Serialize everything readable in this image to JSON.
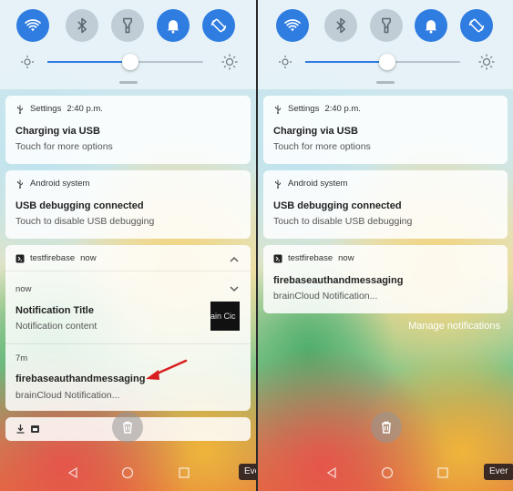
{
  "left_panel": {
    "usb_notification": {
      "app": "Settings",
      "time": "2:40 p.m.",
      "title": "Charging via USB",
      "text": "Touch for more options"
    },
    "debug_notification": {
      "app": "Android system",
      "title": "USB debugging connected",
      "text": "Touch to disable USB debugging"
    },
    "group": {
      "app": "testfirebase",
      "time": "now",
      "item1": {
        "time": "now",
        "title": "Notification Title",
        "text": "Notification content",
        "thumbnail_text": "ain Cic"
      },
      "item2": {
        "time": "7m",
        "title": "firebaseauthandmessaging",
        "text": "brainCloud Notification..."
      }
    },
    "corner_label": "Ever"
  },
  "right_panel": {
    "usb_notification": {
      "app": "Settings",
      "time": "2:40 p.m.",
      "title": "Charging via USB",
      "text": "Touch for more options"
    },
    "debug_notification": {
      "app": "Android system",
      "title": "USB debugging connected",
      "text": "Touch to disable USB debugging"
    },
    "fb_notification": {
      "app": "testfirebase",
      "time": "now",
      "title": "firebaseauthandmessaging",
      "text": "brainCloud Notification..."
    },
    "manage_label": "Manage notifications",
    "corner_label": "Ever"
  },
  "quick_settings": {
    "toggles": [
      {
        "name": "wifi-icon",
        "state": "on"
      },
      {
        "name": "bluetooth-icon",
        "state": "off"
      },
      {
        "name": "flashlight-icon",
        "state": "off"
      },
      {
        "name": "bell-icon",
        "state": "on"
      },
      {
        "name": "auto-rotate-icon",
        "state": "on"
      }
    ],
    "brightness_level": 0.53
  },
  "colors": {
    "accent": "#2f7de1",
    "arrow": "#d81e1e"
  }
}
